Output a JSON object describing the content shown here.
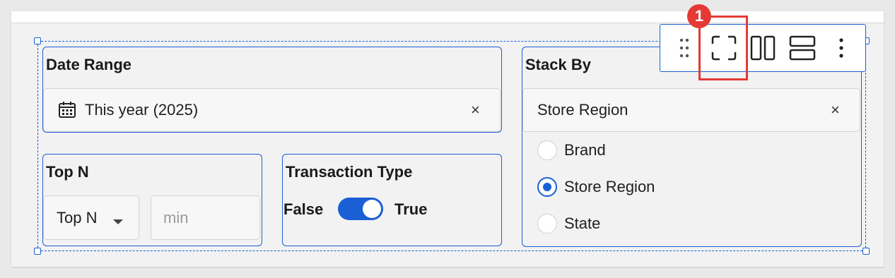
{
  "date_range": {
    "title": "Date Range",
    "value": "This year (2025)",
    "clear_glyph": "×",
    "icon": "calendar-icon"
  },
  "top_n": {
    "title": "Top N",
    "select_value": "Top N",
    "input_placeholder": "min"
  },
  "transaction_type": {
    "title": "Transaction Type",
    "false_label": "False",
    "true_label": "True",
    "value": true
  },
  "stack_by": {
    "title": "Stack By",
    "selected": "Store Region",
    "clear_glyph": "×",
    "options": [
      {
        "label": "Brand",
        "checked": false
      },
      {
        "label": "Store Region",
        "checked": true
      },
      {
        "label": "State",
        "checked": false
      }
    ]
  },
  "toolbar": {
    "items": [
      "drag-handle-icon",
      "fit-to-frame-icon",
      "split-columns-icon",
      "split-rows-icon",
      "more-vertical-icon"
    ]
  },
  "annotation": {
    "step_number": "1",
    "color": "#e53935"
  },
  "colors": {
    "accent": "#1a5fd6",
    "annotation": "#e53935"
  }
}
